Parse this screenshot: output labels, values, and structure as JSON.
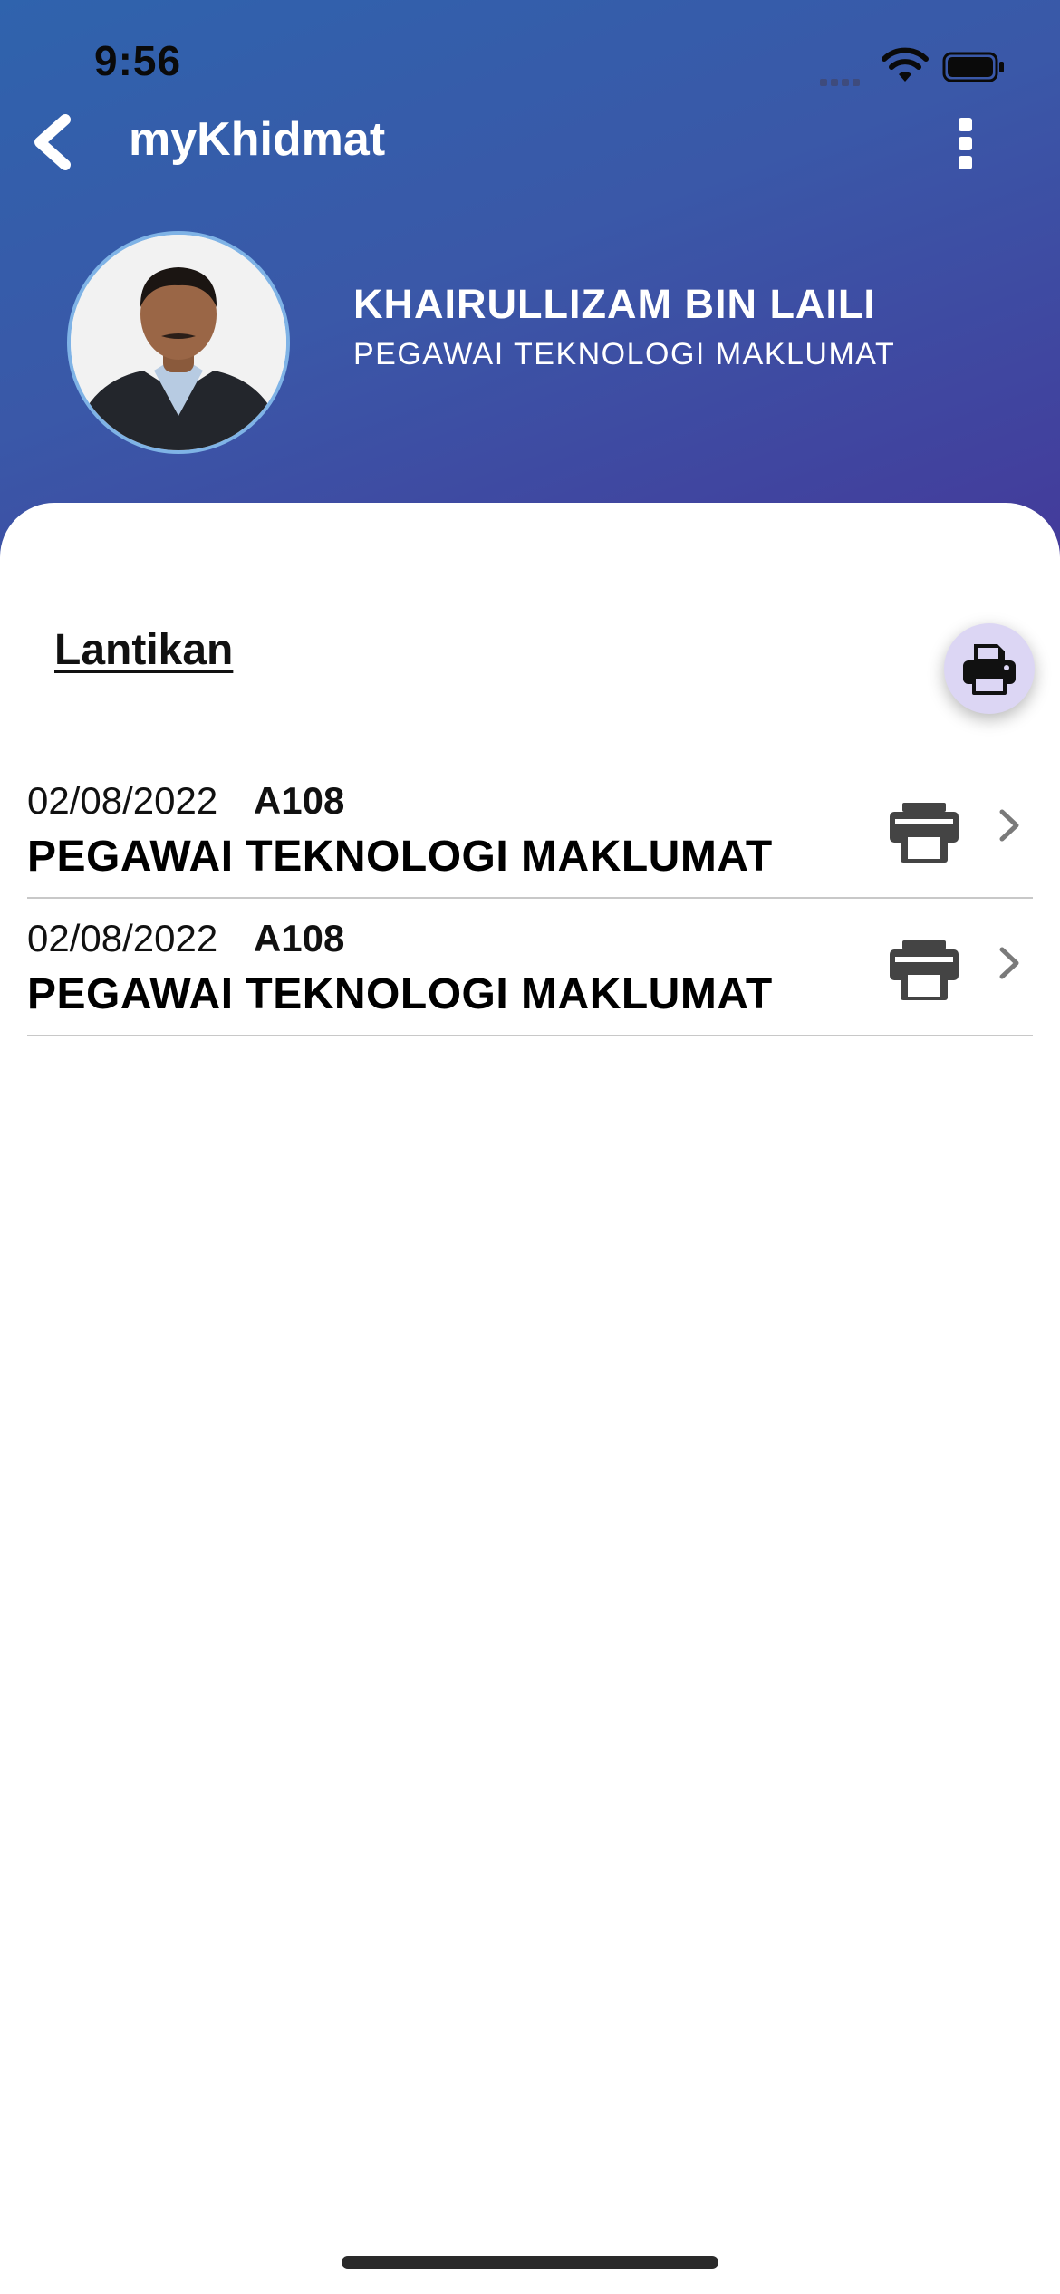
{
  "status_bar": {
    "time": "9:56"
  },
  "app_bar": {
    "title": "myKhidmat",
    "back_icon": "chevron-left-icon",
    "menu_icon": "more-vertical-icon"
  },
  "profile": {
    "name": "KHAIRULLIZAM BIN LAILI",
    "position": "PEGAWAI TEKNOLOGI MAKLUMAT"
  },
  "section": {
    "title": "Lantikan",
    "print_icon": "printer-icon"
  },
  "appointments": [
    {
      "date": "02/08/2022",
      "code": "A108",
      "title": "PEGAWAI TEKNOLOGI MAKLUMAT"
    },
    {
      "date": "02/08/2022",
      "code": "A108",
      "title": "PEGAWAI TEKNOLOGI MAKLUMAT"
    }
  ],
  "colors": {
    "header_gradient_start": "#2f63ad",
    "header_gradient_end": "#44399a",
    "fab_background": "#dcd6f4"
  }
}
